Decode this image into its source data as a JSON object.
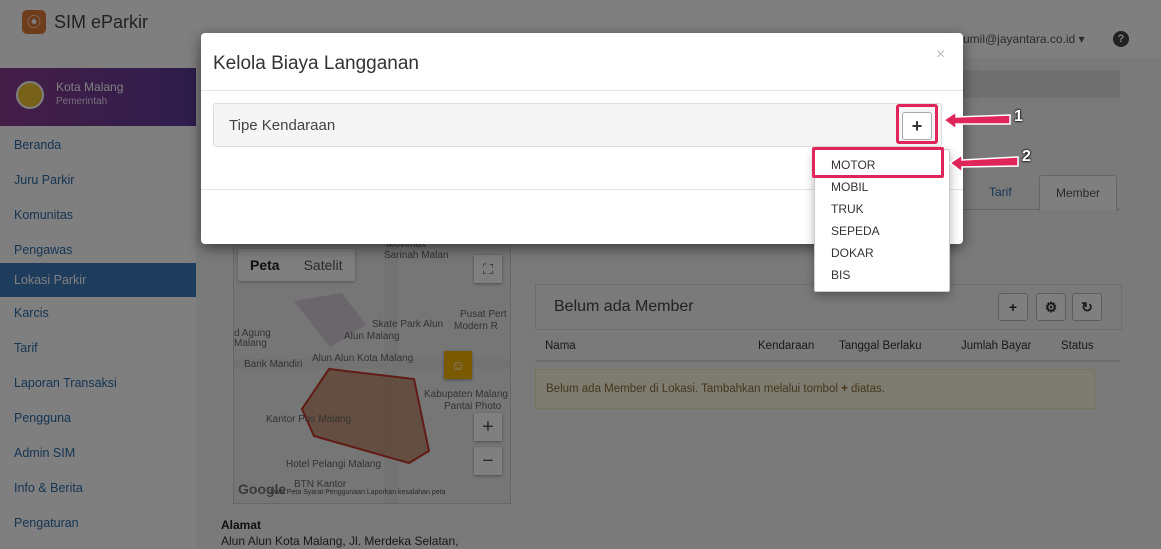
{
  "app": {
    "title": "SIM eParkir"
  },
  "header": {
    "user_email": "umil@jayantara.co.id ▾",
    "help": "?"
  },
  "sidebar": {
    "org_name": "Kota Malang",
    "org_sub": "Pemerintah",
    "items": [
      {
        "label": "Beranda"
      },
      {
        "label": "Juru Parkir"
      },
      {
        "label": "Komunitas"
      },
      {
        "label": "Pengawas"
      },
      {
        "label": "Lokasi Parkir",
        "active": true
      },
      {
        "label": "Karcis"
      },
      {
        "label": "Tarif"
      },
      {
        "label": "Laporan Transaksi"
      },
      {
        "label": "Pengguna"
      },
      {
        "label": "Admin SIM"
      },
      {
        "label": "Info & Berita"
      },
      {
        "label": "Pengaturan"
      }
    ]
  },
  "map": {
    "tab_peta": "Peta",
    "tab_satelit": "Satelit",
    "labels": {
      "movimax": "Movimax",
      "sarinah": "Sarinah Malan",
      "skate_park": "Skate Park Alun",
      "alun_malang": "Alun Malang",
      "pusat_pert": "Pusat Pert",
      "modern": "Modern R",
      "agung": "d Agung",
      "malang": "Malang",
      "bank_mandiri": "Bank Mandiri",
      "alun_kota": "Alun Alun Kota Malang",
      "kabupaten": "Kabupaten Malang",
      "pantai": "Pantai Photo",
      "kantor_pos": "Kantor Pos Malang",
      "hotel": "Hotel Pelangi Malang",
      "btn": "BTN Kantor"
    },
    "google": "Google",
    "footer": "Data Peta   Syarat Penggunaan   Laporkan kesalahan peta"
  },
  "address": {
    "label": "Alamat",
    "value": "Alun Alun Kota Malang, Jl. Merdeka Selatan,"
  },
  "tabs": {
    "tarif": "Tarif",
    "member": "Member"
  },
  "member": {
    "title": "Belum ada Member",
    "columns": [
      "Nama",
      "Kendaraan",
      "Tanggal Berlaku",
      "Jumlah Bayar",
      "Status"
    ],
    "empty_before": "Belum ada Member di Lokasi. Tambahkan melalui tombol",
    "empty_after": "diatas."
  },
  "modal": {
    "title": "Kelola Biaya Langganan",
    "close": "×",
    "vehicle_label": "Tipe Kendaraan",
    "add_button": "+"
  },
  "dropdown": {
    "options": [
      "MOTOR",
      "MOBIL",
      "TRUK",
      "SEPEDA",
      "DOKAR",
      "BIS"
    ]
  },
  "annotations": {
    "step1": "1",
    "step2": "2"
  },
  "colors": {
    "highlight": "#e0255a",
    "sidebar_active": "#3c79b8",
    "brand": "#e07b39"
  }
}
